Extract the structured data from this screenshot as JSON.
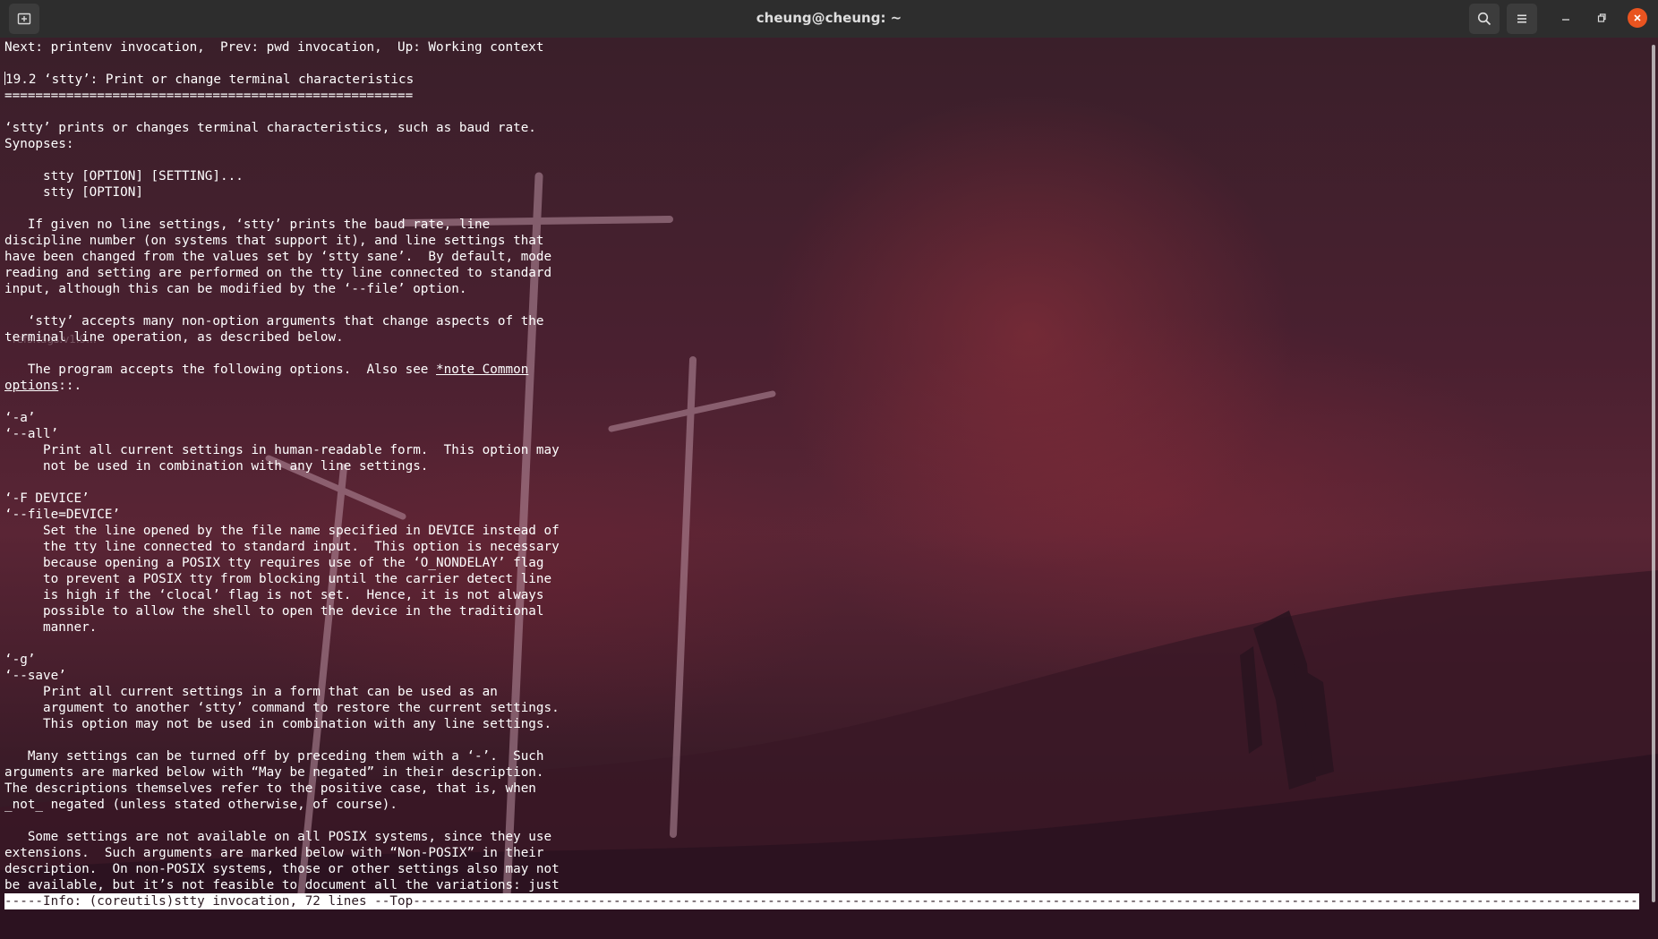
{
  "window": {
    "title": "cheung@cheung: ~",
    "icons": {
      "new_tab": "new-tab-icon",
      "search": "search-icon",
      "menu": "hamburger-menu-icon",
      "minimize": "minimize-icon",
      "maximize": "restore-icon",
      "close": "close-icon"
    },
    "colors": {
      "titlebar": "#2d2d2d",
      "close_button": "#e95420",
      "terminal_text": "#ffffff"
    }
  },
  "background": {
    "ghost_label": "refs.tags.v1.9..."
  },
  "info": {
    "nav": "Next: printenv invocation,  Prev: pwd invocation,  Up: Working context",
    "heading": "19.2 ‘stty’: Print or change terminal characteristics",
    "underline": "=====================================================",
    "intro": [
      "‘stty’ prints or changes terminal characteristics, such as baud rate.",
      "Synopses:"
    ],
    "synopsis": [
      "     stty [OPTION] [SETTING]...",
      "     stty [OPTION]"
    ],
    "para1": [
      "   If given no line settings, ‘stty’ prints the baud rate, line",
      "discipline number (on systems that support it), and line settings that",
      "have been changed from the values set by ‘stty sane’.  By default, mode",
      "reading and setting are performed on the tty line connected to standard",
      "input, although this can be modified by the ‘--file’ option."
    ],
    "para2": [
      "   ‘stty’ accepts many non-option arguments that change aspects of the",
      "terminal line operation, as described below."
    ],
    "options_intro_prefix": "   The program accepts the following options.  Also see ",
    "options_link_a": "*note Common",
    "options_link_b": "options",
    "options_intro_suffix": "::.",
    "opt_a": [
      "‘-a’",
      "‘--all’",
      "     Print all current settings in human-readable form.  This option may",
      "     not be used in combination with any line settings."
    ],
    "opt_F": [
      "‘-F DEVICE’",
      "‘--file=DEVICE’",
      "     Set the line opened by the file name specified in DEVICE instead of",
      "     the tty line connected to standard input.  This option is necessary",
      "     because opening a POSIX tty requires use of the ‘O_NONDELAY’ flag",
      "     to prevent a POSIX tty from blocking until the carrier detect line",
      "     is high if the ‘clocal’ flag is not set.  Hence, it is not always",
      "     possible to allow the shell to open the device in the traditional",
      "     manner."
    ],
    "opt_g": [
      "‘-g’",
      "‘--save’",
      "     Print all current settings in a form that can be used as an",
      "     argument to another ‘stty’ command to restore the current settings.",
      "     This option may not be used in combination with any line settings."
    ],
    "para3": [
      "   Many settings can be turned off by preceding them with a ‘-’.  Such",
      "arguments are marked below with “May be negated” in their description.",
      "The descriptions themselves refer to the positive case, that is, when",
      "_not_ negated (unless stated otherwise, of course)."
    ],
    "para4": [
      "   Some settings are not available on all POSIX systems, since they use",
      "extensions.  Such arguments are marked below with “Non-POSIX” in their",
      "description.  On non-POSIX systems, those or other settings also may not",
      "be available, but it’s not feasible to document all the variations: just"
    ],
    "modeline": "-----Info: (coreutils)stty invocation, 72 lines --Top------------------------------------------------------------------------------------------------------------------------------------------------------------------------------------------------------------------------------------------------------"
  }
}
